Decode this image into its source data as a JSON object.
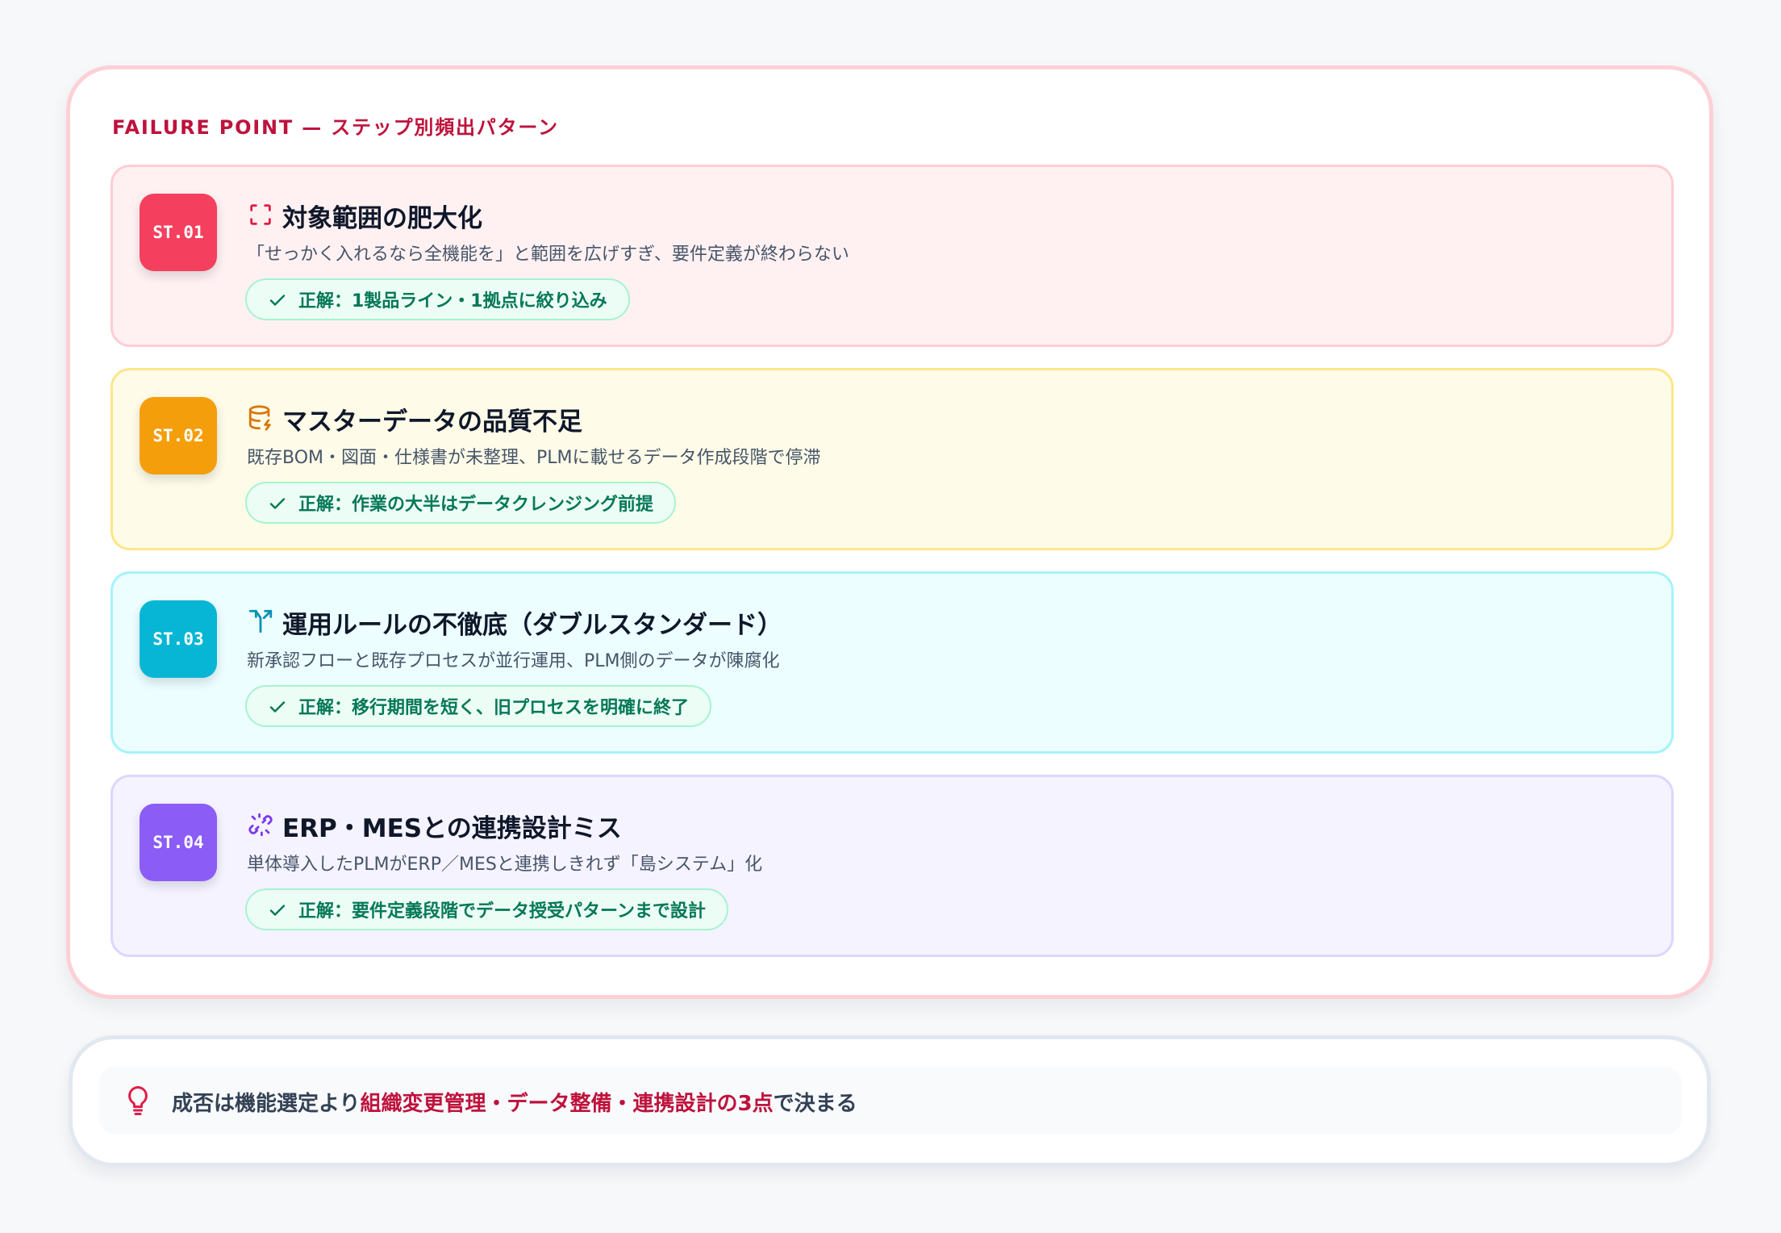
{
  "header": {
    "label": "FAILURE POINT — ステップ別頻出パターン"
  },
  "steps": [
    {
      "badge": "ST.01",
      "icon": "scan-frame-icon",
      "title": "対象範囲の肥大化",
      "description": "「せっかく入れるなら全機能を」と範囲を広げすぎ、要件定義が終わらない",
      "solution": "正解：1製品ライン・1拠点に絞り込み",
      "accent_color": "#f43f5e"
    },
    {
      "badge": "ST.02",
      "icon": "database-warning-icon",
      "title": "マスターデータの品質不足",
      "description": "既存BOM・図面・仕様書が未整理、PLMに載せるデータ作成段階で停滞",
      "solution": "正解：作業の大半はデータクレンジング前提",
      "accent_color": "#f59e0b"
    },
    {
      "badge": "ST.03",
      "icon": "split-arrows-icon",
      "title": "運用ルールの不徹底（ダブルスタンダード）",
      "description": "新承認フローと既存プロセスが並行運用、PLM側のデータが陳腐化",
      "solution": "正解：移行期間を短く、旧プロセスを明確に終了",
      "accent_color": "#06b6d4"
    },
    {
      "badge": "ST.04",
      "icon": "broken-link-icon",
      "title": "ERP・MESとの連携設計ミス",
      "description": "単体導入したPLMがERP／MESと連携しきれず「島システム」化",
      "solution": "正解：要件定義段階でデータ授受パターンまで設計",
      "accent_color": "#8b5cf6"
    }
  ],
  "footer": {
    "icon": "lightbulb-icon",
    "text_before": "成否は機能選定より",
    "text_highlight": "組織変更管理・データ整備・連携設計の3点",
    "text_after": "で決まる",
    "highlight_color": "#be123c"
  }
}
